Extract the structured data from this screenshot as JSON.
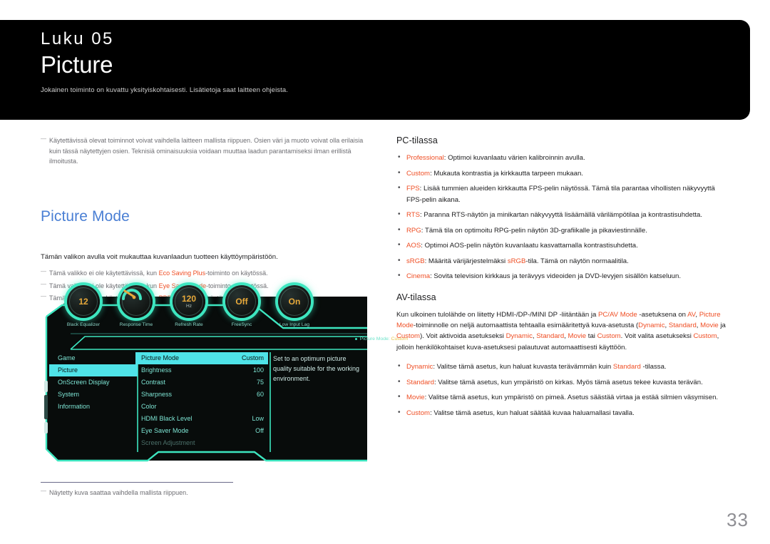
{
  "banner": {
    "chapter": "Luku  05",
    "title": "Picture",
    "subtitle": "Jokainen toiminto on kuvattu yksityiskohtaisesti. Lisätietoja saat laitteen ohjeista."
  },
  "left": {
    "top_note": "Käytettävissä olevat toiminnot voivat vaihdella laitteen mallista riippuen. Osien väri ja muoto voivat olla erilaisia kuin tässä näytettyjen osien. Teknisiä ominaisuuksia voidaan muuttaa laadun parantamiseksi ilman erillistä ilmoitusta.",
    "heading": "Picture Mode",
    "intro": "Tämän valikon avulla voit mukauttaa kuvanlaadun tuotteen käyttöympäristöön.",
    "notes": [
      {
        "pre": "Tämä valikko ei ole käytettävissä, kun ",
        "acc": "Eco Saving Plus",
        "post": "-toiminto on käytössä."
      },
      {
        "pre": "Tämä valikko ei ole käytettävissä, kun ",
        "acc": "Eye Saver Mode",
        "post": "-toiminto on käytössä."
      },
      {
        "pre": "Tämä valikko ei ole käytettävissä, kun ",
        "acc": "PBP",
        "post": "-toiminto on käytössä."
      }
    ]
  },
  "osd": {
    "dials": [
      {
        "label": "Black Equalizer",
        "value": "12",
        "unit": "",
        "type": "value"
      },
      {
        "label": "Response Time",
        "value": "",
        "unit": "",
        "type": "gauge"
      },
      {
        "label": "Refresh Rate",
        "value": "120",
        "unit": "Hz",
        "type": "value"
      },
      {
        "label": "FreeSync",
        "value": "Off",
        "unit": "",
        "type": "value"
      },
      {
        "label": "Low Input Lag",
        "value": "On",
        "unit": "",
        "type": "value"
      }
    ],
    "status_key": "Picture Mode:",
    "status_value": "Custom",
    "nav": [
      {
        "label": "Game",
        "selected": false
      },
      {
        "label": "Picture",
        "selected": true
      },
      {
        "label": "OnScreen Display",
        "selected": false
      },
      {
        "label": "System",
        "selected": false
      },
      {
        "label": "Information",
        "selected": false
      }
    ],
    "items": [
      {
        "label": "Picture Mode",
        "value": "Custom",
        "selected": true,
        "dim": false
      },
      {
        "label": "Brightness",
        "value": "100",
        "selected": false,
        "dim": false
      },
      {
        "label": "Contrast",
        "value": "75",
        "selected": false,
        "dim": false
      },
      {
        "label": "Sharpness",
        "value": "60",
        "selected": false,
        "dim": false
      },
      {
        "label": "Color",
        "value": "",
        "selected": false,
        "dim": false
      },
      {
        "label": "HDMI Black Level",
        "value": "Low",
        "selected": false,
        "dim": false
      },
      {
        "label": "Eye Saver Mode",
        "value": "Off",
        "selected": false,
        "dim": false
      },
      {
        "label": "Screen Adjustment",
        "value": "",
        "selected": false,
        "dim": true
      }
    ],
    "help_text": "Set to an optimum picture quality suitable for the working environment."
  },
  "right": {
    "pc_heading": "PC-tilassa",
    "pc_items": [
      {
        "acc": "Professional",
        "text": ": Optimoi kuvanlaatu värien kalibroinnin avulla."
      },
      {
        "acc": "Custom",
        "text": ": Mukauta kontrastia ja kirkkautta tarpeen mukaan."
      },
      {
        "acc": "FPS",
        "text": ": Lisää tummien alueiden kirkkautta FPS-pelin näytössä. Tämä tila parantaa vihollisten näkyvyyttä FPS-pelin aikana."
      },
      {
        "acc": "RTS",
        "text": ": Paranna RTS-näytön ja minikartan näkyvyyttä lisäämällä värilämpötilaa ja kontrastisuhdetta."
      },
      {
        "acc": "RPG",
        "text": ": Tämä tila on optimoitu RPG-pelin näytön 3D-grafiikalle ja pikaviestinnälle."
      },
      {
        "acc": "AOS",
        "text": ": Optimoi AOS-pelin näytön kuvanlaatu kasvattamalla kontrastisuhdetta."
      },
      {
        "acc": "sRGB",
        "text": ": Määritä värijärjestelmäksi ",
        "acc2": "sRGB",
        "text2": "-tila. Tämä on näytön normaalitila."
      },
      {
        "acc": "Cinema",
        "text": ": Sovita television kirkkaus ja terävyys videoiden ja DVD-levyjen sisällön katseluun."
      }
    ],
    "av_heading": "AV-tilassa",
    "av_paragraph": {
      "p1": "Kun ulkoinen tulolähde on liitetty HDMI-/DP-/MINI DP -liitäntään ja ",
      "a1": "PC/AV Mode",
      "p2": " -asetuksena on ",
      "a2": "AV",
      "p3": ", ",
      "a3": "Picture Mode",
      "p4": "-toiminnolle on neljä automaattista tehtaalla esimääritettyä kuva-asetusta (",
      "a4": "Dynamic",
      "p5": ", ",
      "a5": "Standard",
      "p6": ", ",
      "a6": "Movie",
      "p7": " ja ",
      "a7": "Custom",
      "p8": "). Voit aktivoida asetukseksi ",
      "a8": "Dynamic",
      "p9": ", ",
      "a9": "Standard",
      "p10": ", ",
      "a10": "Movie",
      "p11": " tai ",
      "a11": "Custom",
      "p12": ". Voit valita asetukseksi ",
      "a12": "Custom",
      "p13": ", jolloin henkilökohtaiset kuva-asetuksesi palautuvat automaattisesti käyttöön."
    },
    "av_items": [
      {
        "acc": "Dynamic",
        "text": ": Valitse tämä asetus, kun haluat kuvasta terävämmän kuin ",
        "acc2": "Standard",
        "text2": " -tilassa."
      },
      {
        "acc": "Standard",
        "text": ": Valitse tämä asetus, kun ympäristö on kirkas. Myös tämä asetus tekee kuvasta terävän."
      },
      {
        "acc": "Movie",
        "text": ": Valitse tämä asetus, kun ympäristö on pimeä. Asetus säästää virtaa ja estää silmien väsymisen."
      },
      {
        "acc": "Custom",
        "text": ": Valitse tämä asetus, kun haluat säätää kuvaa haluamallasi tavalla."
      }
    ]
  },
  "footer": {
    "note": "Näytetty kuva saattaa vaihdella mallista riippuen.",
    "page": "33"
  },
  "colors": {
    "accent": "#ef4e24",
    "heading_blue": "#4a7fd4",
    "osd_teal": "#3de6c0",
    "osd_amber": "#e8a93a",
    "osd_highlight": "#4fe3e8"
  }
}
